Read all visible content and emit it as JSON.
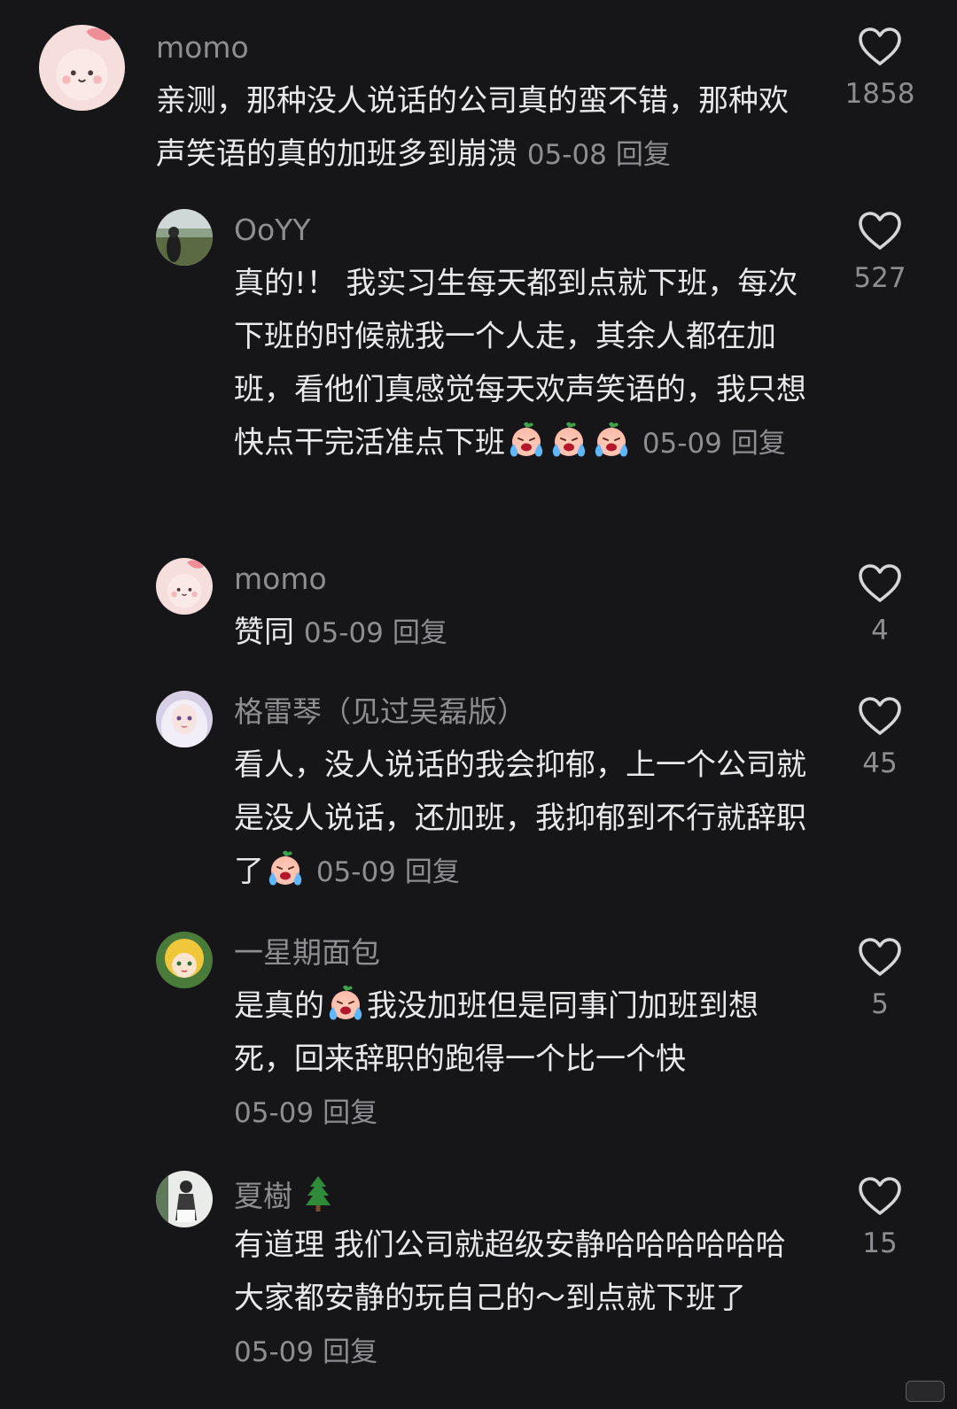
{
  "comments": [
    {
      "user": "momo",
      "text_before": "亲测，那种没人说话的公司真的蛮不错，那种欢声笑语的真的加班多到崩溃",
      "text_after": "",
      "date": "05-08",
      "reply_label": "回复",
      "likes": "1858"
    },
    {
      "user": "OoYY",
      "text_before": "真的!！ 我实习生每天都到点就下班，每次下班的时候就我一个人走，其余人都在加班，看他们真感觉每天欢声笑语的，我只想快点干完活准点下班",
      "text_after": "",
      "date": "05-09",
      "reply_label": "回复",
      "likes": "527"
    },
    {
      "user": "momo",
      "text_before": "赞同",
      "text_after": "",
      "date": "05-09",
      "reply_label": "回复",
      "likes": "4"
    },
    {
      "user": "格雷琴（见过吴磊版）",
      "text_before": "看人，没人说话的我会抑郁，上一个公司就是没人说话，还加班，我抑郁到不行就辞职了",
      "text_after": "",
      "date": "05-09",
      "reply_label": "回复",
      "likes": "45"
    },
    {
      "user": "一星期面包",
      "text_before": "是真的",
      "text_after": "我没加班但是同事门加班到想死，回来辞职的跑得一个比一个快",
      "date": "05-09",
      "reply_label": "回复",
      "likes": "5"
    },
    {
      "user": "夏樹",
      "user_emoji": "🌲",
      "text_before": "有道理 我们公司就超级安静哈哈哈哈哈哈 大家都安静的玩自己的～到点就下班了",
      "text_after": "",
      "date": "05-09",
      "reply_label": "回复",
      "likes": "15"
    }
  ],
  "icons": {
    "like": "heart-outline-icon",
    "cry_emoji": "loudly-crying-face-emoji",
    "tree_emoji": "evergreen-tree-emoji"
  },
  "colors": {
    "background": "#161618",
    "text": "#e9e9ea",
    "muted": "#8d8d92"
  }
}
